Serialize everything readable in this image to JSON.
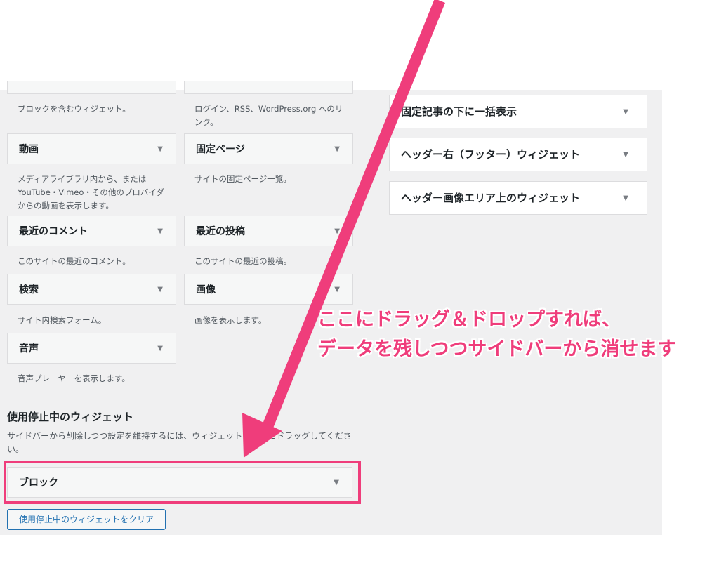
{
  "available_widgets": {
    "partial_left_desc": "ブロックを含むウィジェット。",
    "partial_right_desc": "ログイン、RSS、WordPress.org へのリンク。",
    "items": [
      {
        "title": "動画",
        "desc": "メディアライブラリ内から、またはYouTube・Vimeo・その他のプロバイダからの動画を表示します。"
      },
      {
        "title": "固定ページ",
        "desc": "サイトの固定ページ一覧。"
      },
      {
        "title": "最近のコメント",
        "desc": "このサイトの最近のコメント。"
      },
      {
        "title": "最近の投稿",
        "desc": "このサイトの最近の投稿。"
      },
      {
        "title": "検索",
        "desc": "サイト内検索フォーム。"
      },
      {
        "title": "画像",
        "desc": "画像を表示します。"
      },
      {
        "title": "音声",
        "desc": "音声プレーヤーを表示します。"
      }
    ]
  },
  "widget_areas": [
    {
      "title": "固定記事の下に一括表示"
    },
    {
      "title": "ヘッダー右（フッター）ウィジェット"
    },
    {
      "title": "ヘッダー画像エリア上のウィジェット"
    }
  ],
  "inactive": {
    "title": "使用停止中のウィジェット",
    "desc": "サイドバーから削除しつつ設定を維持するには、ウィジェットをここにドラッグしてください。",
    "widget_title": "ブロック",
    "clear_button": "使用停止中のウィジェットをクリア"
  },
  "annotation": {
    "line1": "ここにドラッグ＆ドロップすれば、",
    "line2": "データを残しつつサイドバーから消せます",
    "color": "#ef3d7b"
  },
  "icons": {
    "dropdown": "triangle-down-icon"
  },
  "colors": {
    "panel_bg": "#f0f0f1",
    "widget_bg": "#f6f7f7",
    "accent": "#2271b1",
    "highlight": "#ef3d7b"
  }
}
